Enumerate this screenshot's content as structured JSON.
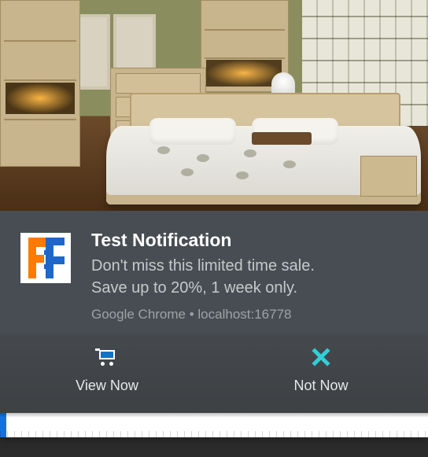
{
  "hero": {
    "alt": "Bedroom furniture set with bed, wooden cabinets, lamp and wall art"
  },
  "app": {
    "icon_name": "furniture-hub-icon"
  },
  "notification": {
    "title": "Test Notification",
    "message_line1": "Don't miss this limited time sale.",
    "message_line2": "Save up to 20%, 1 week only.",
    "source": "Google Chrome • localhost:16778"
  },
  "actions": {
    "primary": {
      "label": "View Now",
      "icon": "cart-icon"
    },
    "secondary": {
      "label": "Not Now",
      "icon": "close-icon"
    }
  },
  "colors": {
    "accent_cyan": "#2fd0d8",
    "cart_blue": "#1570c9",
    "panel": "#474d52"
  }
}
